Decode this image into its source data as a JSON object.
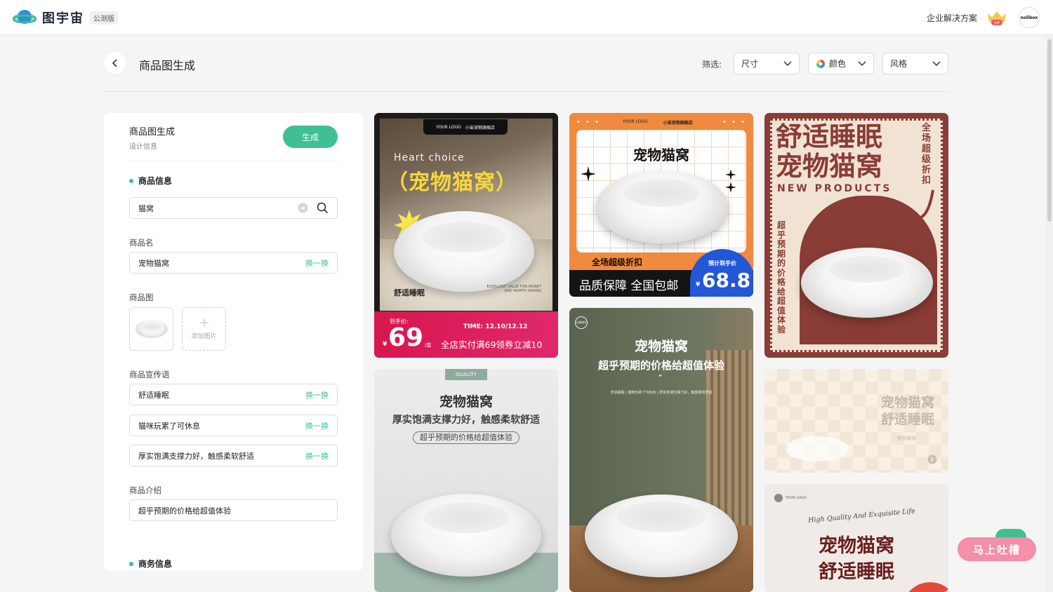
{
  "header": {
    "brand": "图宇宙",
    "badge": "公测版",
    "enterprise": "企业解决方案",
    "vip_label": "VIP",
    "avatar_text": "nolibox"
  },
  "page": {
    "title": "商品图生成",
    "filter_label": "筛选:",
    "filters": {
      "size": "尺寸",
      "color": "颜色",
      "style": "风格"
    }
  },
  "panel": {
    "title": "商品图生成",
    "subtitle": "设计信息",
    "generate": "生成",
    "section_product": "商品信息",
    "search_value": "猫窝",
    "name_label": "商品名",
    "name_value": "宠物猫窝",
    "swap": "换一换",
    "image_label": "商品图",
    "add_image": "添加图片",
    "slogan_label": "商品宣传语",
    "slogans": [
      "舒适睡眠",
      "猫咪玩累了可休息",
      "厚实饱满支撑力好，触感柔软舒适"
    ],
    "intro_label": "商品介绍",
    "intro_value": "超乎预期的价格给超值体验",
    "section_business": "商务信息"
  },
  "cards": {
    "c1": {
      "logo": "YOUR LOGO",
      "shop": "小宙宠物旗舰店",
      "en": "Heart choice",
      "title": "（宠物猫窝）",
      "tag": "舒适睡眠",
      "small_en": "EXCELLENT VALUE FOR MONEY AND WORTH HAVING",
      "price_label": "到手价:",
      "currency": "¥",
      "price": "69",
      "unit": "/盒",
      "time": "TIME: 12.10/12.12",
      "promo": "全店实付满69领券立减10"
    },
    "c2": {
      "logo": "YOUR LOGO",
      "shop": "小宙宠物旗舰店",
      "title": "宠物猫窝",
      "discount": "全场超级折扣",
      "slogan": "品质保障 全国包邮",
      "price_label": "预计到手价",
      "currency": "¥",
      "price": "68.8"
    },
    "c3": {
      "title1": "舒适睡眠",
      "title2": "宠物猫窝",
      "en": "NEW PRODUCTS",
      "side": "全场超级折扣",
      "vertical": "超乎预期的价格给超值体验"
    },
    "c4": {
      "badge": "QUALITY",
      "title": "宠物猫窝",
      "subtitle": "厚实饱满支撑力好，触感柔软舒适",
      "pill": "超乎预期的价格给超值体验"
    },
    "c5": {
      "logo": "计算美学",
      "title": "宠物猫窝",
      "subtitle": "超乎预期的价格给超值体验",
      "quote": "\"",
      "small": "舒适睡眠 | 猫咪玩累了可休息 | 厚实饱满支撑力好，触感柔软舒适"
    },
    "c6": {
      "title1": "宠物猫窝",
      "title2": "舒适睡眠",
      "small": "宠物猫窝"
    },
    "c7": {
      "logo": "YOUR LOGO",
      "script": "High Quality And Exquisite Life",
      "title1": "宠物猫窝",
      "title2": "舒适睡眠"
    }
  },
  "feedback": "马上吐槽"
}
